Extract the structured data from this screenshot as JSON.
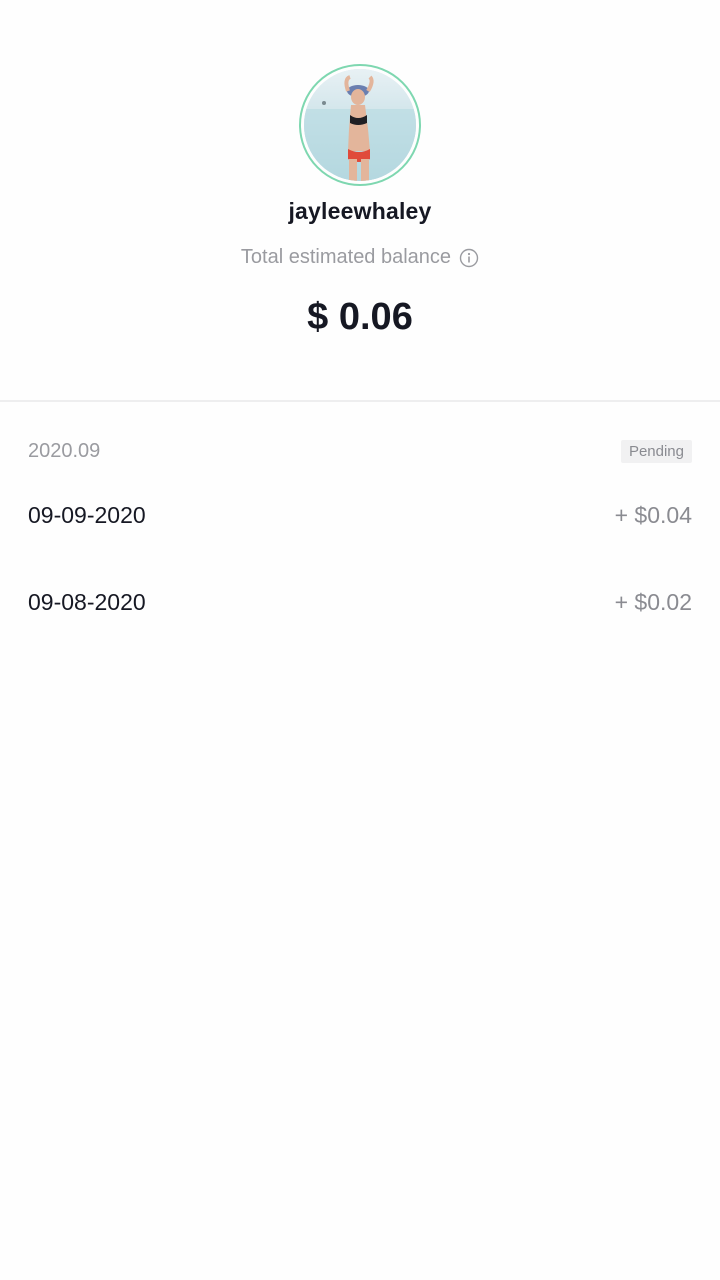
{
  "profile": {
    "username": "jayleewhaley",
    "balance_label": "Total estimated balance",
    "balance_amount": "$ 0.06"
  },
  "icons": {
    "info": "info-circle-icon"
  },
  "transactions": {
    "month": "2020.09",
    "status": "Pending",
    "items": [
      {
        "date": "09-09-2020",
        "amount": "+ $0.04"
      },
      {
        "date": "09-08-2020",
        "amount": "+ $0.02"
      }
    ]
  },
  "colors": {
    "avatar_ring": "#7ed7b0",
    "text_primary": "#161823",
    "text_secondary": "#9a9ba0"
  }
}
